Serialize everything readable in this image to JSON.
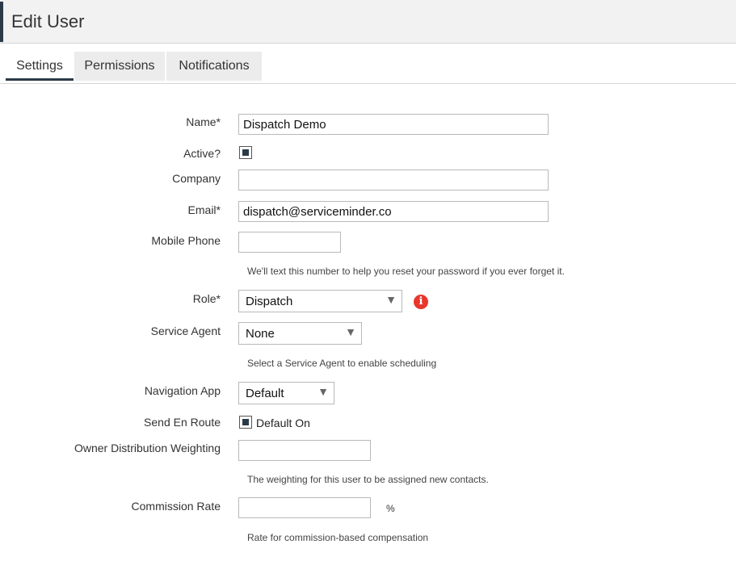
{
  "header": {
    "title": "Edit User"
  },
  "tabs": [
    {
      "label": "Settings"
    },
    {
      "label": "Permissions"
    },
    {
      "label": "Notifications"
    }
  ],
  "form": {
    "name": {
      "label": "Name*",
      "value": "Dispatch Demo"
    },
    "active": {
      "label": "Active?",
      "checked": true
    },
    "company": {
      "label": "Company",
      "value": ""
    },
    "email": {
      "label": "Email*",
      "value": "dispatch@serviceminder.co"
    },
    "mobile_phone": {
      "label": "Mobile Phone",
      "value": "",
      "help": "We'll text this number to help you reset your password if you ever forget it."
    },
    "role": {
      "label": "Role*",
      "value": "Dispatch",
      "info_icon": "info-icon"
    },
    "service_agent": {
      "label": "Service Agent",
      "value": "None",
      "help": "Select a Service Agent to enable scheduling"
    },
    "navigation_app": {
      "label": "Navigation App",
      "value": "Default"
    },
    "send_en_route": {
      "label": "Send En Route",
      "checked": true,
      "option_label": "Default On"
    },
    "owner_distribution_weighting": {
      "label": "Owner Distribution Weighting",
      "value": "",
      "help": "The weighting for this user to be assigned new contacts."
    },
    "commission_rate": {
      "label": "Commission Rate",
      "value": "",
      "suffix": "%",
      "help": "Rate for commission-based compensation"
    }
  },
  "colors": {
    "accent": "#2b3a47",
    "info": "#e8372c",
    "header_bg": "#f2f2f2"
  },
  "icons": {
    "select_arrow": "triangle-down-icon",
    "checkbox": "checkbox-icon"
  }
}
